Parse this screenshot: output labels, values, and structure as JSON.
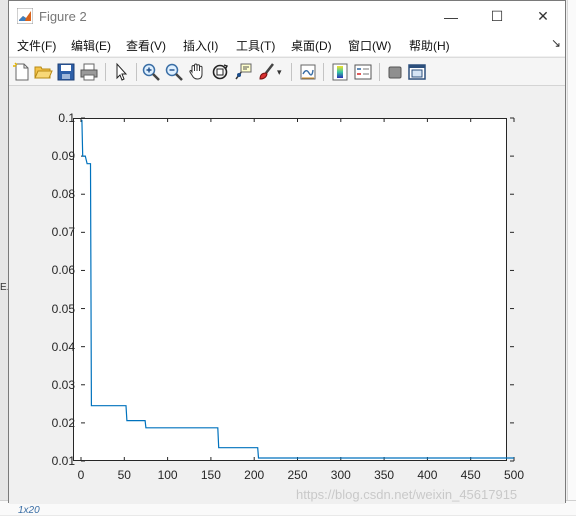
{
  "window": {
    "title": "Figure 2",
    "minimize": "—",
    "maximize": "☐",
    "close": "✕"
  },
  "menu": [
    {
      "label": "文件(F)"
    },
    {
      "label": "编辑(E)"
    },
    {
      "label": "查看(V)"
    },
    {
      "label": "插入(I)"
    },
    {
      "label": "工具(T)"
    },
    {
      "label": "桌面(D)"
    },
    {
      "label": "窗口(W)"
    },
    {
      "label": "帮助(H)"
    }
  ],
  "toolbar": [
    {
      "icon": "new-figure-icon"
    },
    {
      "icon": "open-file-icon"
    },
    {
      "icon": "save-icon"
    },
    {
      "icon": "print-icon"
    },
    {
      "icon": "edit-plot-icon"
    },
    {
      "icon": "zoom-in-icon"
    },
    {
      "icon": "zoom-out-icon"
    },
    {
      "icon": "pan-icon"
    },
    {
      "icon": "rotate-3d-icon"
    },
    {
      "icon": "data-cursor-icon"
    },
    {
      "icon": "brush-icon"
    },
    {
      "icon": "link-plot-icon"
    },
    {
      "icon": "insert-colorbar-icon"
    },
    {
      "icon": "insert-legend-icon"
    },
    {
      "icon": "hide-plot-tools-icon"
    },
    {
      "icon": "show-plot-tools-icon"
    }
  ],
  "background": {
    "side_text": "E.r",
    "bottom_label": "1x20"
  },
  "watermark": "https://blog.csdn.net/weixin_45617915",
  "chart_data": {
    "type": "line",
    "xlim": [
      0,
      500
    ],
    "ylim": [
      0.01,
      0.1
    ],
    "xticks": [
      "0",
      "50",
      "100",
      "150",
      "200",
      "250",
      "300",
      "350",
      "400",
      "450",
      "500"
    ],
    "yticks": [
      "0.01",
      "0.02",
      "0.03",
      "0.04",
      "0.05",
      "0.06",
      "0.07",
      "0.08",
      "0.09",
      "0.1"
    ],
    "grid": false,
    "line_color": "#0072BD",
    "series": [
      {
        "x": [
          1,
          2,
          3,
          4,
          5,
          6,
          7,
          8,
          9,
          10,
          11,
          12,
          13,
          52,
          53,
          74,
          75,
          158,
          159,
          204,
          205,
          500
        ],
        "y": [
          0.0995,
          0.09,
          0.09,
          0.09,
          0.09,
          0.089,
          0.088,
          0.088,
          0.088,
          0.088,
          0.088,
          0.0245,
          0.0245,
          0.0245,
          0.0206,
          0.0206,
          0.0187,
          0.0187,
          0.0135,
          0.0135,
          0.0108,
          0.0108
        ]
      }
    ]
  }
}
